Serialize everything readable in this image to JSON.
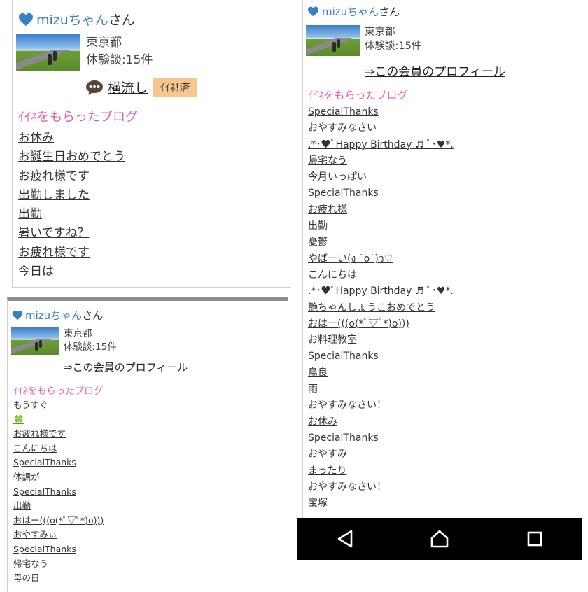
{
  "colors": {
    "name": "#3a7fc6",
    "section": "#e25fb2",
    "iine_button_bg": "#f6c590",
    "navbar_bg": "#000000"
  },
  "panel_a": {
    "user_name": "mizuちゃん",
    "honorific": "さん",
    "location": "東京都",
    "experience": "体験談:15件",
    "share_label": "横流し",
    "iine_label": "ｲｲﾈ!済",
    "section_title": "ｲｲﾈをもらったブログ",
    "blogs": [
      "お休み",
      "お誕生日おめでとう",
      "お疲れ様です",
      "出勤しました",
      "出勤",
      "暑いですね？",
      "お疲れ様です",
      "今日は"
    ]
  },
  "panel_b": {
    "user_name": "mizuちゃん",
    "honorific": "さん",
    "location": "東京都",
    "experience": "体験談:15件",
    "profile_link": "⇒この会員のプロフィール",
    "section_title": "ｲｲﾈをもらったブログ",
    "blogs": [
      "もうすぐ",
      "🍀",
      "お疲れ様です",
      "こんにちは",
      "SpecialThanks",
      "体調が",
      "SpecialThanks",
      "出勤",
      "おはー(((o(*ﾟ▽ﾟ*)o)))",
      "おやすみぃ",
      "SpecialThanks",
      "帰宅なう",
      "母の日"
    ]
  },
  "panel_c": {
    "user_name": "mizuちゃん",
    "honorific": "さん",
    "location": "東京都",
    "experience": "体験談:15件",
    "profile_link": "⇒この会員のプロフィール",
    "section_title": "ｲｲﾈをもらったブログ",
    "blogs": [
      "SpecialThanks",
      "おやすみなさい",
      ".*･♥ﾟHappy Birthday ♬ ﾟ･♥*.",
      "帰宅なう",
      "今月いっぱい",
      "SpecialThanks",
      "お疲れ様",
      "出勤",
      "憂鬱",
      "やばーい(ง ˙o˙)ว♡",
      "こんにちは",
      ".*･♥ﾟHappy Birthday ♬ ﾟ･♥*.",
      "艶ちゃんしょうこおめでとう",
      "おはー(((o(*ﾟ▽ﾟ*)o)))",
      "お料理教室",
      "SpecialThanks",
      "鳥良",
      "雨",
      "おやすみなさい！",
      "お休み",
      "SpecialThanks",
      "おやすみ",
      "まったり",
      "おやすみなさい！",
      "宝塚"
    ]
  },
  "navbar": {
    "back_icon": "back-triangle-icon",
    "home_icon": "home-icon",
    "recents_icon": "recents-square-icon"
  }
}
